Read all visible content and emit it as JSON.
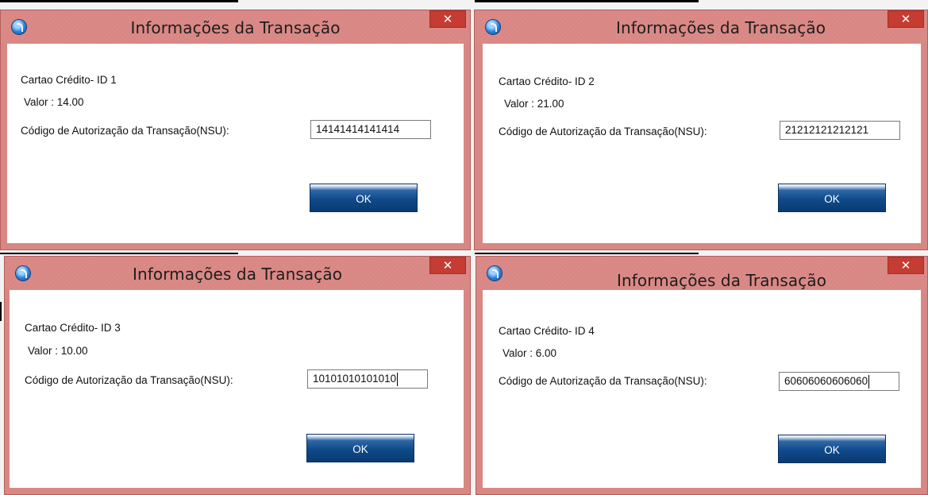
{
  "dialogs": [
    {
      "title": "Informações da Transação",
      "close_label": "✕",
      "card_label": "Cartao Crédito- ID 1",
      "valor_label": "Valor : 14.00",
      "nsu_label": "Código de Autorização da Transação(NSU):",
      "nsu_value": "14141414141414",
      "ok_label": "OK"
    },
    {
      "title": "Informações da Transação",
      "close_label": "✕",
      "card_label": "Cartao Crédito- ID 2",
      "valor_label": "Valor : 21.00",
      "nsu_label": "Código de Autorização da Transação(NSU):",
      "nsu_value": "21212121212121",
      "ok_label": "OK"
    },
    {
      "title": "Informações da Transação",
      "close_label": "✕",
      "card_label": "Cartao Crédito- ID 3",
      "valor_label": "Valor : 10.00",
      "nsu_label": "Código de Autorização da Transação(NSU):",
      "nsu_value": "10101010101010",
      "ok_label": "OK"
    },
    {
      "title": "Informações da Transação",
      "close_label": "✕",
      "card_label": "Cartao Crédito- ID 4",
      "valor_label": "Valor : 6.00",
      "nsu_label": "Código de Autorização da Transação(NSU):",
      "nsu_value": "60606060606060",
      "ok_label": "OK"
    }
  ],
  "colors": {
    "titlebar": "#d98784",
    "close": "#c43c32",
    "ok": "#0f4a8a"
  },
  "icons": {
    "app": "app-logo-icon",
    "close": "close-icon"
  }
}
